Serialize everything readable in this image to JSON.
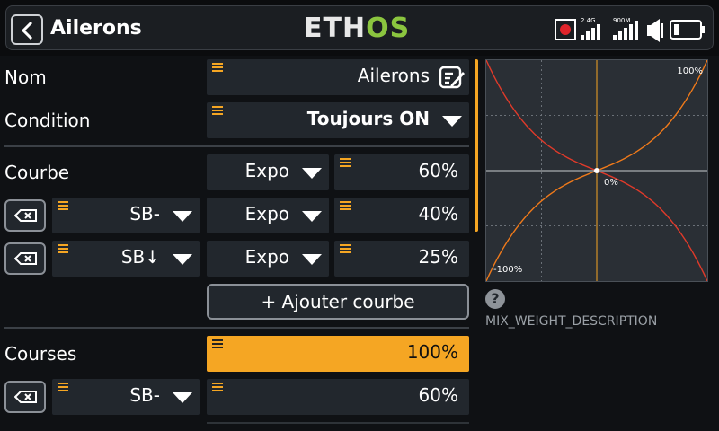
{
  "header": {
    "title": "Ailerons",
    "logo_left": "ETH",
    "logo_right": "OS",
    "rssi1_label": "2.4G",
    "rssi2_label": "900M"
  },
  "form": {
    "name_label": "Nom",
    "name_value": "Ailerons",
    "condition_label": "Condition",
    "condition_value": "Toujours ON",
    "curve_label": "Courbe",
    "curve_type": "Expo",
    "curve_value": "60%",
    "curve_rows": [
      {
        "switch": "SB-",
        "type": "Expo",
        "value": "40%"
      },
      {
        "switch": "SB↓",
        "type": "Expo",
        "value": "25%"
      }
    ],
    "add_curve": "+ Ajouter courbe",
    "rates_label": "Courses",
    "rates_value": "100%",
    "rates_rows": [
      {
        "switch": "SB-",
        "value": "60%"
      }
    ]
  },
  "graph": {
    "top_label": "100%",
    "center_label": "0%",
    "bottom_label": "-100%",
    "expo": 0.6
  },
  "help": {
    "icon": "?",
    "description": "MIX_WEIGHT_DESCRIPTION"
  },
  "colors": {
    "accent": "#f5a623",
    "curve_orange": "#f07a1a",
    "curve_red": "#e03a2a"
  }
}
